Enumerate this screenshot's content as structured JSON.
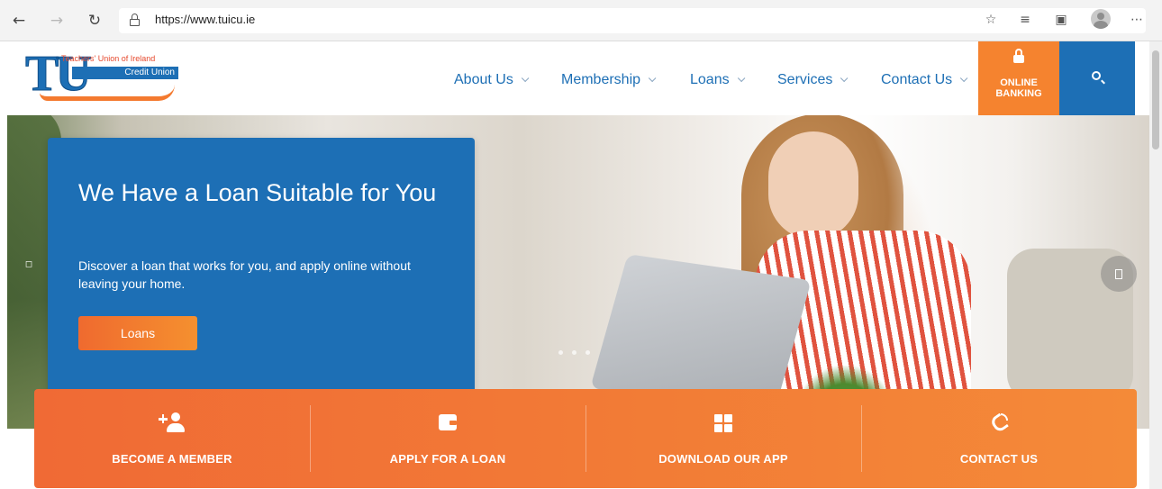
{
  "browser": {
    "url": "https://www.tuicu.ie",
    "icons": [
      "back-icon",
      "forward-icon",
      "refresh-icon",
      "lock-icon",
      "favorite-star-icon",
      "favorites-list-icon",
      "collections-icon",
      "profile-icon",
      "more-icon"
    ]
  },
  "site": {
    "logo": {
      "monogram": "TU",
      "top_line": "Teachers' Union of Ireland",
      "credit_union": "Credit Union"
    },
    "nav": [
      "About Us",
      "Membership",
      "Loans",
      "Services",
      "Contact Us"
    ],
    "online_banking": {
      "line1": "ONLINE",
      "line2": "BANKING"
    },
    "colors": {
      "primary_blue": "#1d6fb5",
      "accent_orange": "#f5832f"
    }
  },
  "hero": {
    "title": "We Have a Loan Suitable for You",
    "subtitle": "Discover a loan that works for you, and apply online without leaving your home.",
    "button": "Loans"
  },
  "quick_links": [
    {
      "label": "BECOME A MEMBER",
      "icon": "add-user-icon"
    },
    {
      "label": "APPLY FOR A LOAN",
      "icon": "wallet-icon"
    },
    {
      "label": "DOWNLOAD OUR APP",
      "icon": "app-grid-icon"
    },
    {
      "label": "CONTACT US",
      "icon": "phone-icon"
    }
  ]
}
